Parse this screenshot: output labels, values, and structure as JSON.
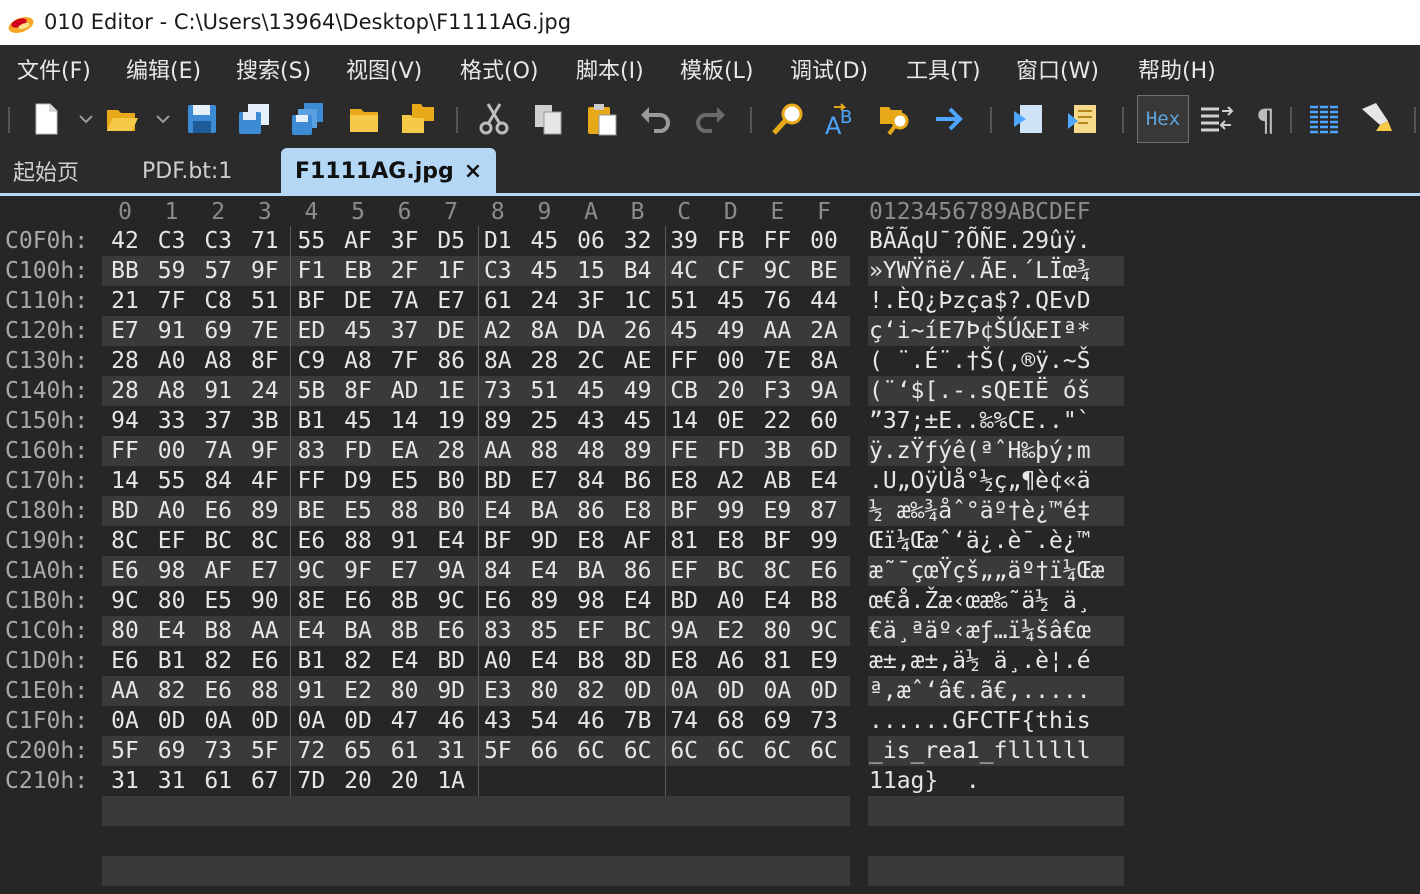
{
  "window": {
    "title": "010 Editor - C:\\Users\\13964\\Desktop\\F1111AG.jpg"
  },
  "menu": [
    "文件(F)",
    "编辑(E)",
    "搜索(S)",
    "视图(V)",
    "格式(O)",
    "脚本(I)",
    "模板(L)",
    "调试(D)",
    "工具(T)",
    "窗口(W)",
    "帮助(H)"
  ],
  "toolbar": {
    "hex_label": "Hex"
  },
  "tabs": [
    {
      "label": "起始页"
    },
    {
      "label": "PDF.bt:1"
    },
    {
      "label": "F1111AG.jpg",
      "active": true
    }
  ],
  "hex": {
    "columns": [
      "0",
      "1",
      "2",
      "3",
      "4",
      "5",
      "6",
      "7",
      "8",
      "9",
      "A",
      "B",
      "C",
      "D",
      "E",
      "F"
    ],
    "ascii_header": "0123456789ABCDEF",
    "rows": [
      {
        "offset": "C0F0h:",
        "bytes": "42 C3 C3 71 55 AF 3F D5 D1 45 06 32 39 FB FF 00",
        "ascii": "BÃÃqU¯?ÕÑE.29ûÿ."
      },
      {
        "offset": "C100h:",
        "bytes": "BB 59 57 9F F1 EB 2F 1F C3 45 15 B4 4C CF 9C BE",
        "ascii": "»YWŸñë/.ÃE.´LÏœ¾"
      },
      {
        "offset": "C110h:",
        "bytes": "21 7F C8 51 BF DE 7A E7 61 24 3F 1C 51 45 76 44",
        "ascii": "!.ÈQ¿Þzça$?.QEvD"
      },
      {
        "offset": "C120h:",
        "bytes": "E7 91 69 7E ED 45 37 DE A2 8A DA 26 45 49 AA 2A",
        "ascii": "ç‘i~íE7Þ¢ŠÚ&EIª*"
      },
      {
        "offset": "C130h:",
        "bytes": "28 A0 A8 8F C9 A8 7F 86 8A 28 2C AE FF 00 7E 8A",
        "ascii": "( ¨.É¨.†Š(,®ÿ.~Š"
      },
      {
        "offset": "C140h:",
        "bytes": "28 A8 91 24 5B 8F AD 1E 73 51 45 49 CB 20 F3 9A",
        "ascii": "(¨‘$[.-.sQEIË óš"
      },
      {
        "offset": "C150h:",
        "bytes": "94 33 37 3B B1 45 14 19 89 25 43 45 14 0E 22 60",
        "ascii": "”37;±E..‰%CE..\"`"
      },
      {
        "offset": "C160h:",
        "bytes": "FF 00 7A 9F 83 FD EA 28 AA 88 48 89 FE FD 3B 6D",
        "ascii": "ÿ.zŸƒýê(ªˆH‰þý;m"
      },
      {
        "offset": "C170h:",
        "bytes": "14 55 84 4F FF D9 E5 B0 BD E7 84 B6 E8 A2 AB E4",
        "ascii": ".U„OÿÙå°½ç„¶è¢«ä"
      },
      {
        "offset": "C180h:",
        "bytes": "BD A0 E6 89 BE E5 88 B0 E4 BA 86 E8 BF 99 E9 87",
        "ascii": "½ æ‰¾åˆ°äº†è¿™é‡"
      },
      {
        "offset": "C190h:",
        "bytes": "8C EF BC 8C E6 88 91 E4 BF 9D E8 AF 81 E8 BF 99",
        "ascii": "Œï¼Œæˆ‘ä¿.è¯.è¿™"
      },
      {
        "offset": "C1A0h:",
        "bytes": "E6 98 AF E7 9C 9F E7 9A 84 E4 BA 86 EF BC 8C E6",
        "ascii": "æ˜¯çœŸçš„„äº†ï¼Œæ"
      },
      {
        "offset": "C1B0h:",
        "bytes": "9C 80 E5 90 8E E6 8B 9C E6 89 98 E4 BD A0 E4 B8",
        "ascii": "œ€å.Žæ‹œæ‰˜ä½ ä¸"
      },
      {
        "offset": "C1C0h:",
        "bytes": "80 E4 B8 AA E4 BA 8B E6 83 85 EF BC 9A E2 80 9C",
        "ascii": "€ä¸ªäº‹æƒ…ï¼šâ€œ"
      },
      {
        "offset": "C1D0h:",
        "bytes": "E6 B1 82 E6 B1 82 E4 BD A0 E4 B8 8D E8 A6 81 E9",
        "ascii": "æ±‚æ±‚ä½ ä¸.è¦.é"
      },
      {
        "offset": "C1E0h:",
        "bytes": "AA 82 E6 88 91 E2 80 9D E3 80 82 0D 0A 0D 0A 0D",
        "ascii": "ª‚æˆ‘â€.ã€‚....."
      },
      {
        "offset": "C1F0h:",
        "bytes": "0A 0D 0A 0D 0A 0D 47 46 43 54 46 7B 74 68 69 73",
        "ascii": "......GFCTF{this"
      },
      {
        "offset": "C200h:",
        "bytes": "5F 69 73 5F 72 65 61 31 5F 66 6C 6C 6C 6C 6C 6C",
        "ascii": "_is_rea1_fllllll"
      },
      {
        "offset": "C210h:",
        "bytes": "31 31 61 67 7D 20 20 1A",
        "ascii": "11ag}  ."
      }
    ]
  }
}
